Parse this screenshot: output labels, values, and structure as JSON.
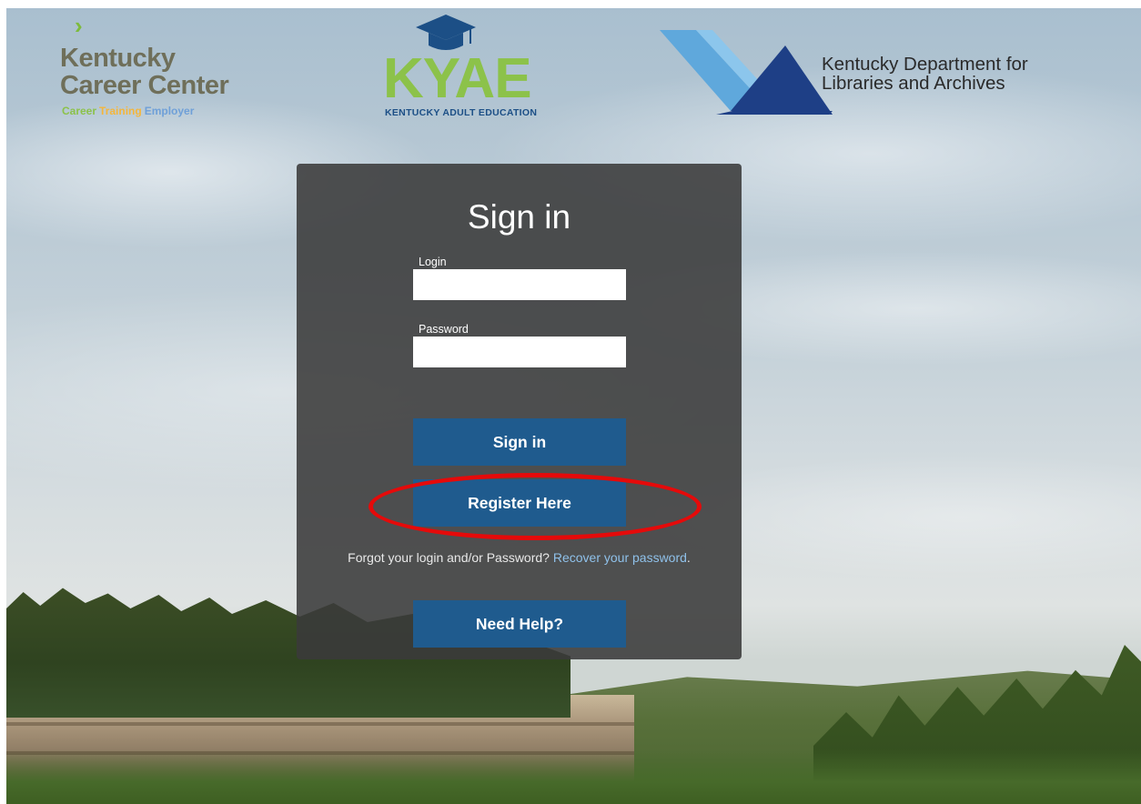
{
  "logos": {
    "kentucky_career_center": {
      "line1": "Kentucky",
      "line2": "Career Center",
      "tagline": [
        "Career",
        "Training",
        "Employer"
      ],
      "tagline_colors": [
        "#8cc24a",
        "#f4b63c",
        "#6fa0d8"
      ]
    },
    "kyae": {
      "letters": "KYAE",
      "subtitle": "KENTUCKY ADULT EDUCATION"
    },
    "kdla": {
      "line1": "Kentucky Department for",
      "line2": "Libraries and Archives"
    }
  },
  "signin": {
    "title": "Sign in",
    "login_label": "Login",
    "login_value": "",
    "password_label": "Password",
    "password_value": "",
    "signin_button": "Sign in",
    "register_button": "Register Here",
    "forgot_text": "Forgot your login and/or Password?",
    "recover_link": "Recover your password",
    "forgot_suffix": ".",
    "help_button": "Need Help?"
  },
  "colors": {
    "panel": "#3a3a3a",
    "button": "#1f5b8e",
    "link": "#8fc1ea",
    "highlight_ring": "#e50a0a"
  }
}
